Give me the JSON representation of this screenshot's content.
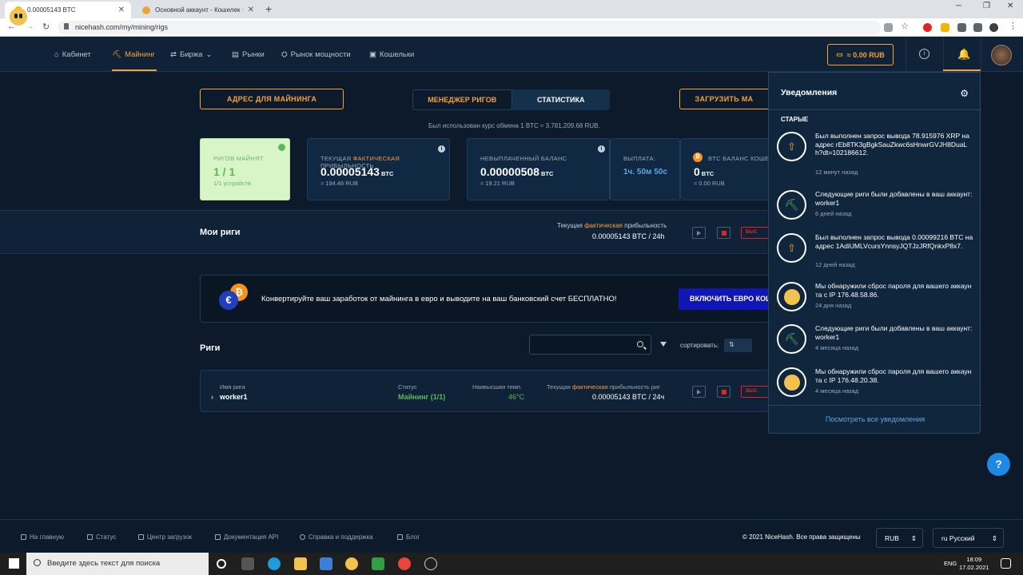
{
  "browser": {
    "tabs": [
      {
        "title": "0.00005143 BTC",
        "close": "✕"
      },
      {
        "title": "Основной аккаунт - Кошелек - ...",
        "close": "✕"
      }
    ],
    "new_tab": "+",
    "url": "nicehash.com/my/mining/rigs",
    "controls": {
      "minimize": "─",
      "maximize": "❐",
      "close": "✕"
    }
  },
  "header": {
    "nav": [
      {
        "label": "Кабинет",
        "icon": "home-icon"
      },
      {
        "label": "Майнинг",
        "icon": "pickaxe-icon"
      },
      {
        "label": "Биржа",
        "icon": "exchange-icon"
      },
      {
        "label": "Рынки",
        "icon": "markets-icon"
      },
      {
        "label": "Рынок мощности",
        "icon": "hashpower-icon"
      },
      {
        "label": "Кошельки",
        "icon": "wallet-icon"
      }
    ],
    "balance": "≈ 0.00 RUB",
    "info": "i"
  },
  "main": {
    "mining_address_btn": "АДРЕС ДЛЯ МАЙНИНГА",
    "tabs": [
      "МЕНЕДЖЕР РИГОВ",
      "СТАТИСТИКА"
    ],
    "download_btn": "ЗАГРУЗИТЬ МА",
    "rate_note": "Был использован курс обмена 1 BTC ≈ 3,781,209.68 RUB.",
    "cards": {
      "rigs": {
        "label": "РИГОВ МАЙНЯТ",
        "value": "1 / 1",
        "sub": "1/1 устройств"
      },
      "profit": {
        "label_pre": "ТЕКУЩАЯ ",
        "label_hl": "ФАКТИЧЕСКАЯ",
        "label_post": " ПРИБЫЛЬНОСТЬ",
        "value": "0.00005143",
        "unit": "BTC",
        "sub": "≈ 194.46 RUB"
      },
      "unpaid": {
        "label": "НЕВЫПЛАЧЕННЫЙ БАЛАНС",
        "value": "0.00000508",
        "unit": "BTC",
        "sub": "≈ 19.21 RUB"
      },
      "payout": {
        "label": "ВЫПЛАТА:",
        "value": "1ч. 50м 50с"
      },
      "btc_wallet": {
        "label": "BTC БАЛАНС КОШЕЛ",
        "value": "0",
        "unit": "BTC",
        "sub": "≈ 0.00 RUB"
      }
    },
    "my_rigs": {
      "title": "Мои риги",
      "profit_label_pre": "Текущая ",
      "profit_label_hl": "фактическая",
      "profit_label_post": " прибыльность",
      "profit_value": "0.00005143 BTC / 24h",
      "red_btn": "ВЫС"
    },
    "banner": {
      "text": "Конвертируйте ваш заработок от майнинга в евро и выводите на ваш банковский счет БЕСПЛАТНО!",
      "button": "ВКЛЮЧИТЬ ЕВРО КОШ",
      "euro": "€",
      "btc": "₿"
    },
    "rigs_section": {
      "title": "Риги",
      "sort_label": "сортировать:",
      "sort_value": "⇅"
    },
    "rig": {
      "name_label": "Имя рига",
      "name": "worker1",
      "status_label": "Статус",
      "status": "Майнинг (1/1)",
      "temp_label": "Наивысшая темп.",
      "temp": "46°C",
      "profit_label_pre": "Текущая ",
      "profit_label_hl": "фактическая",
      "profit_label_post": " прибыльность риг",
      "profit": "0.00005143 BTC / 24ч",
      "red_btn": "ВЫС"
    }
  },
  "notifications": {
    "title": "Уведомления",
    "group": "СТАРЫЕ",
    "items": [
      {
        "icon": "upload-icon",
        "text": "Был выполнен запрос вывода 78.915976 XRP на адрес rEb8TK3gBgkSauZkwc6sHnwrGVJH8DuaLh?dt=102186612.",
        "time": "12 минут назад"
      },
      {
        "icon": "pickaxe-icon",
        "text": "Следующие риги были добавлены в ваш аккаунт: worker1",
        "time": "6 дней назад"
      },
      {
        "icon": "upload-icon",
        "text": "Был выполнен запрос вывода 0.00099216 BTC на адрес 1AdiUMLVcursYnnsyJQTJzJRfQnkxP8x7.",
        "time": "12 дней назад"
      },
      {
        "icon": "nicehash-logo-icon",
        "text": "Мы обнаружили сброс пароля для вашего аккаунта с IP 176.48.58.86.",
        "time": "24 дня назад"
      },
      {
        "icon": "pickaxe-icon",
        "text": "Следующие риги были добавлены в ваш аккаунт: worker1",
        "time": "4 месяца назад"
      },
      {
        "icon": "nicehash-logo-icon",
        "text": "Мы обнаружили сброс пароля для вашего аккаунта с IP 176.48.20.38.",
        "time": "4 месяца назад"
      }
    ],
    "view_all": "Посмотреть все уведомления"
  },
  "help_label": "?",
  "footer": {
    "links": [
      {
        "label": "На главную",
        "icon": "home-icon"
      },
      {
        "label": "Статус",
        "icon": "status-icon"
      },
      {
        "label": "Центр загрузок",
        "icon": "download-icon"
      },
      {
        "label": "Документация API",
        "icon": "doc-icon"
      },
      {
        "label": "Справка и поддержка",
        "icon": "help-icon"
      },
      {
        "label": "Блог",
        "icon": "blog-icon"
      }
    ],
    "copyright": "© 2021 NiceHash. Все права защищены",
    "currency": "RUB",
    "language": "ru Русский"
  },
  "taskbar": {
    "search_placeholder": "Введите здесь текст для поиска",
    "lang": "ENG",
    "time": "18:09",
    "date": "17.02.2021"
  },
  "colors": {
    "accent": "#f6a13a",
    "bg": "#0c1a2b",
    "panel": "#10263d",
    "green": "#5cb85c",
    "red": "#e02424",
    "link": "#5ea7e8"
  }
}
